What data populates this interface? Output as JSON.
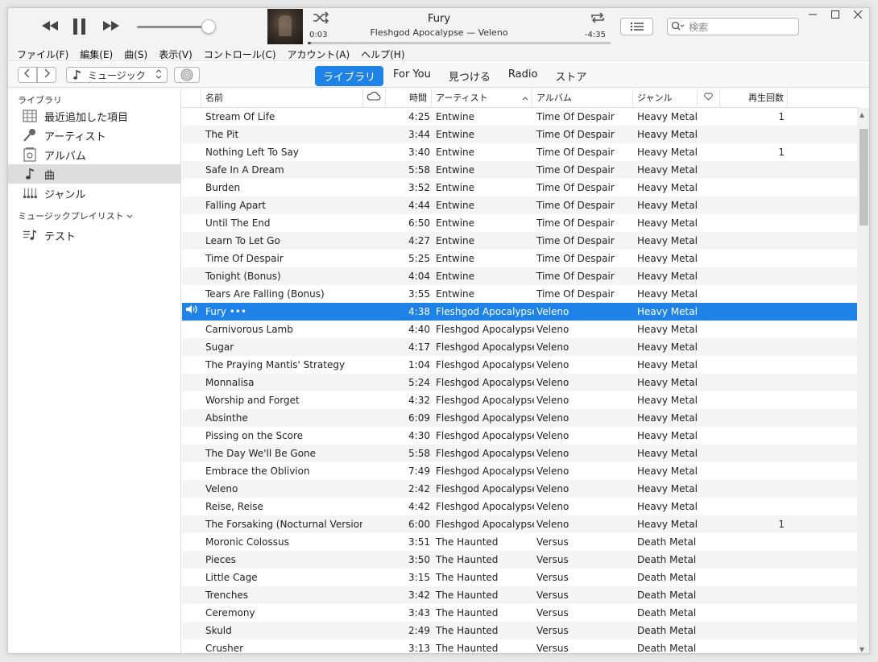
{
  "player": {
    "song_title": "Fury",
    "song_subtitle": "Fleshgod Apocalypse — Veleno",
    "elapsed": "0:03",
    "remaining": "-4:35",
    "progress": 0.011,
    "volume": 0.85,
    "search_placeholder": "検索"
  },
  "menu": [
    "ファイル(F)",
    "編集(E)",
    "曲(S)",
    "表示(V)",
    "コントロール(C)",
    "アカウント(A)",
    "ヘルプ(H)"
  ],
  "nav": {
    "media_kind": "ミュージック",
    "tabs": [
      {
        "label": "ライブラリ",
        "active": true
      },
      {
        "label": "For You",
        "active": false
      },
      {
        "label": "見つける",
        "active": false
      },
      {
        "label": "Radio",
        "active": false
      },
      {
        "label": "ストア",
        "active": false
      }
    ]
  },
  "sidebar": {
    "library_heading": "ライブラリ",
    "library_items": [
      {
        "label": "最近追加した項目",
        "icon": "recently-added-icon"
      },
      {
        "label": "アーティスト",
        "icon": "microphone-icon"
      },
      {
        "label": "アルバム",
        "icon": "album-icon"
      },
      {
        "label": "曲",
        "icon": "note-icon",
        "selected": true
      },
      {
        "label": "ジャンル",
        "icon": "genre-icon"
      }
    ],
    "playlists_heading": "ミュージックプレイリスト",
    "playlists": [
      {
        "label": "テスト",
        "icon": "playlist-icon"
      }
    ]
  },
  "table": {
    "headers": {
      "name": "名前",
      "time": "時間",
      "artist": "アーティスト",
      "album": "アルバム",
      "genre": "ジャンル",
      "plays": "再生回数"
    },
    "rows": [
      {
        "name": "Stream Of Life",
        "time": "4:25",
        "artist": "Entwine",
        "album": "Time Of Despair",
        "genre": "Heavy Metal",
        "plays": "1"
      },
      {
        "name": "The Pit",
        "time": "3:44",
        "artist": "Entwine",
        "album": "Time Of Despair",
        "genre": "Heavy Metal",
        "plays": ""
      },
      {
        "name": "Nothing Left To Say",
        "time": "3:40",
        "artist": "Entwine",
        "album": "Time Of Despair",
        "genre": "Heavy Metal",
        "plays": "1"
      },
      {
        "name": "Safe In A Dream",
        "time": "5:58",
        "artist": "Entwine",
        "album": "Time Of Despair",
        "genre": "Heavy Metal",
        "plays": ""
      },
      {
        "name": "Burden",
        "time": "3:52",
        "artist": "Entwine",
        "album": "Time Of Despair",
        "genre": "Heavy Metal",
        "plays": ""
      },
      {
        "name": "Falling Apart",
        "time": "4:44",
        "artist": "Entwine",
        "album": "Time Of Despair",
        "genre": "Heavy Metal",
        "plays": ""
      },
      {
        "name": "Until The End",
        "time": "6:50",
        "artist": "Entwine",
        "album": "Time Of Despair",
        "genre": "Heavy Metal",
        "plays": ""
      },
      {
        "name": "Learn To Let Go",
        "time": "4:27",
        "artist": "Entwine",
        "album": "Time Of Despair",
        "genre": "Heavy Metal",
        "plays": ""
      },
      {
        "name": "Time Of Despair",
        "time": "5:25",
        "artist": "Entwine",
        "album": "Time Of Despair",
        "genre": "Heavy Metal",
        "plays": ""
      },
      {
        "name": "Tonight (Bonus)",
        "time": "4:04",
        "artist": "Entwine",
        "album": "Time Of Despair",
        "genre": "Heavy Metal",
        "plays": ""
      },
      {
        "name": "Tears Are Falling (Bonus)",
        "time": "3:55",
        "artist": "Entwine",
        "album": "Time Of Despair",
        "genre": "Heavy Metal",
        "plays": ""
      },
      {
        "name": "Fury •••",
        "time": "4:38",
        "artist": "Fleshgod Apocalypse",
        "album": "Veleno",
        "genre": "Heavy Metal",
        "plays": "",
        "playing": true
      },
      {
        "name": "Carnivorous Lamb",
        "time": "4:40",
        "artist": "Fleshgod Apocalypse",
        "album": "Veleno",
        "genre": "Heavy Metal",
        "plays": ""
      },
      {
        "name": "Sugar",
        "time": "4:17",
        "artist": "Fleshgod Apocalypse",
        "album": "Veleno",
        "genre": "Heavy Metal",
        "plays": ""
      },
      {
        "name": "The Praying Mantis' Strategy",
        "time": "1:04",
        "artist": "Fleshgod Apocalypse",
        "album": "Veleno",
        "genre": "Heavy Metal",
        "plays": ""
      },
      {
        "name": "Monnalisa",
        "time": "5:24",
        "artist": "Fleshgod Apocalypse",
        "album": "Veleno",
        "genre": "Heavy Metal",
        "plays": ""
      },
      {
        "name": "Worship and Forget",
        "time": "4:32",
        "artist": "Fleshgod Apocalypse",
        "album": "Veleno",
        "genre": "Heavy Metal",
        "plays": ""
      },
      {
        "name": "Absinthe",
        "time": "6:09",
        "artist": "Fleshgod Apocalypse",
        "album": "Veleno",
        "genre": "Heavy Metal",
        "plays": ""
      },
      {
        "name": "Pissing on the Score",
        "time": "4:30",
        "artist": "Fleshgod Apocalypse",
        "album": "Veleno",
        "genre": "Heavy Metal",
        "plays": ""
      },
      {
        "name": "The Day We'll Be Gone",
        "time": "5:58",
        "artist": "Fleshgod Apocalypse",
        "album": "Veleno",
        "genre": "Heavy Metal",
        "plays": ""
      },
      {
        "name": "Embrace the Oblivion",
        "time": "7:49",
        "artist": "Fleshgod Apocalypse",
        "album": "Veleno",
        "genre": "Heavy Metal",
        "plays": ""
      },
      {
        "name": "Veleno",
        "time": "2:42",
        "artist": "Fleshgod Apocalypse",
        "album": "Veleno",
        "genre": "Heavy Metal",
        "plays": ""
      },
      {
        "name": "Reise, Reise",
        "time": "4:42",
        "artist": "Fleshgod Apocalypse",
        "album": "Veleno",
        "genre": "Heavy Metal",
        "plays": ""
      },
      {
        "name": "The Forsaking (Nocturnal Version)",
        "time": "6:00",
        "artist": "Fleshgod Apocalypse",
        "album": "Veleno",
        "genre": "Heavy Metal",
        "plays": "1"
      },
      {
        "name": "Moronic Colossus",
        "time": "3:51",
        "artist": "The Haunted",
        "album": "Versus",
        "genre": "Death Metal",
        "plays": ""
      },
      {
        "name": "Pieces",
        "time": "3:50",
        "artist": "The Haunted",
        "album": "Versus",
        "genre": "Death Metal",
        "plays": ""
      },
      {
        "name": "Little Cage",
        "time": "3:15",
        "artist": "The Haunted",
        "album": "Versus",
        "genre": "Death Metal",
        "plays": ""
      },
      {
        "name": "Trenches",
        "time": "3:42",
        "artist": "The Haunted",
        "album": "Versus",
        "genre": "Death Metal",
        "plays": ""
      },
      {
        "name": "Ceremony",
        "time": "3:43",
        "artist": "The Haunted",
        "album": "Versus",
        "genre": "Death Metal",
        "plays": ""
      },
      {
        "name": "Skuld",
        "time": "2:49",
        "artist": "The Haunted",
        "album": "Versus",
        "genre": "Death Metal",
        "plays": ""
      },
      {
        "name": "Crusher",
        "time": "3:13",
        "artist": "The Haunted",
        "album": "Versus",
        "genre": "Death Metal",
        "plays": ""
      }
    ]
  },
  "colors": {
    "accent": "#1e82e6",
    "selection": "#1e82e6"
  }
}
